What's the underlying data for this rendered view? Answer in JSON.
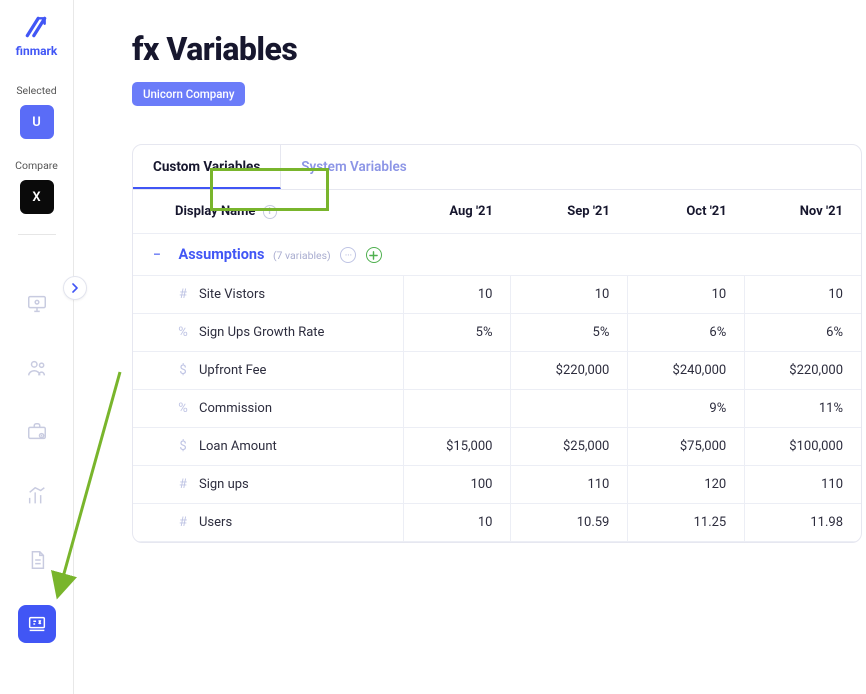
{
  "brand": "finmark",
  "sidebar": {
    "selected_label": "Selected",
    "compare_label": "Compare",
    "selected_letter": "U",
    "compare_letter": "X"
  },
  "page": {
    "title": "fx Variables",
    "company_badge": "Unicorn Company"
  },
  "tabs": {
    "custom": "Custom Variables",
    "system": "System Variables"
  },
  "table": {
    "header_name": "Display Name",
    "columns": [
      "Aug '21",
      "Sep '21",
      "Oct '21",
      "Nov '21"
    ],
    "group": {
      "name": "Assumptions",
      "count_label": "(7 variables)"
    },
    "rows": [
      {
        "type": "#",
        "name": "Site Vistors",
        "values": [
          "10",
          "10",
          "10",
          "10"
        ]
      },
      {
        "type": "%",
        "name": "Sign Ups Growth Rate",
        "values": [
          "5%",
          "5%",
          "6%",
          "6%"
        ]
      },
      {
        "type": "$",
        "name": "Upfront Fee",
        "values": [
          "",
          "$220,000",
          "$240,000",
          "$220,000"
        ]
      },
      {
        "type": "%",
        "name": "Commission",
        "values": [
          "",
          "",
          "9%",
          "11%"
        ]
      },
      {
        "type": "$",
        "name": "Loan Amount",
        "values": [
          "$15,000",
          "$25,000",
          "$75,000",
          "$100,000"
        ]
      },
      {
        "type": "#",
        "name": "Sign ups",
        "values": [
          "100",
          "110",
          "120",
          "110"
        ]
      },
      {
        "type": "#",
        "name": "Users",
        "values": [
          "10",
          "10.59",
          "11.25",
          "11.98"
        ]
      }
    ]
  }
}
